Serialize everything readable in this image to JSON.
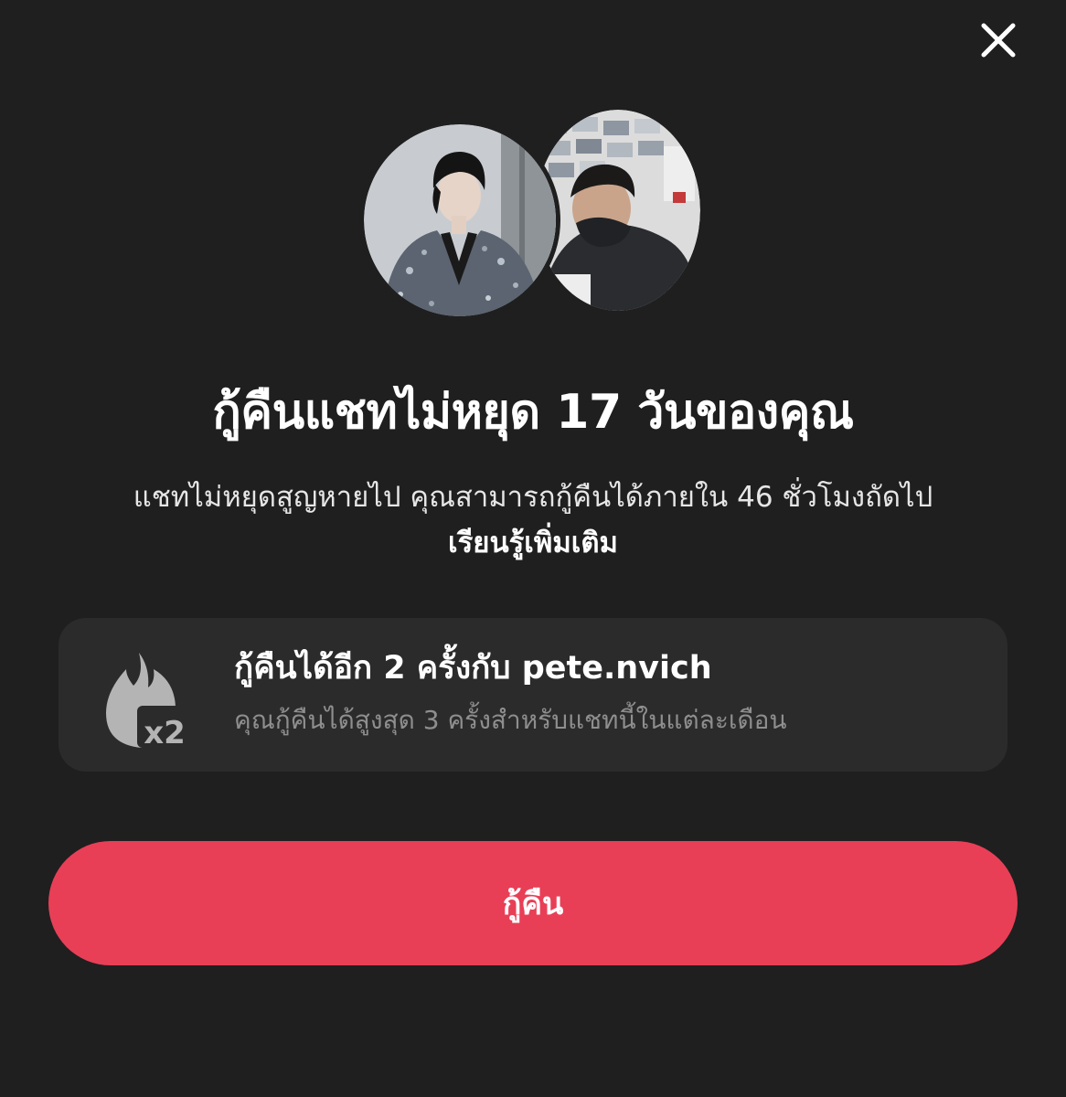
{
  "close": {
    "icon": "close-icon"
  },
  "avatars": [
    {
      "icon": "avatar-user"
    },
    {
      "icon": "avatar-friend"
    }
  ],
  "title": "กู้คืนแชทไม่หยุด 17 วันของคุณ",
  "subtitle": "แชทไม่หยุดสูญหายไป คุณสามารถกู้คืนได้ภายใน 46 ชั่วโมงถัดไป",
  "learn_more": "เรียนรู้เพิ่มเติม",
  "card": {
    "icon": "flame-x2-icon",
    "badge": "x2",
    "title": "กู้คืนได้อีก 2 ครั้งกับ pete.nvich",
    "subtitle": "คุณกู้คืนได้สูงสุด 3 ครั้งสำหรับแชทนี้ในแต่ละเดือน"
  },
  "restore_button": "กู้คืน",
  "colors": {
    "background": "#1f1f1f",
    "card": "#2b2b2b",
    "accent": "#e83f57",
    "muted_text": "#8e8e8e"
  }
}
